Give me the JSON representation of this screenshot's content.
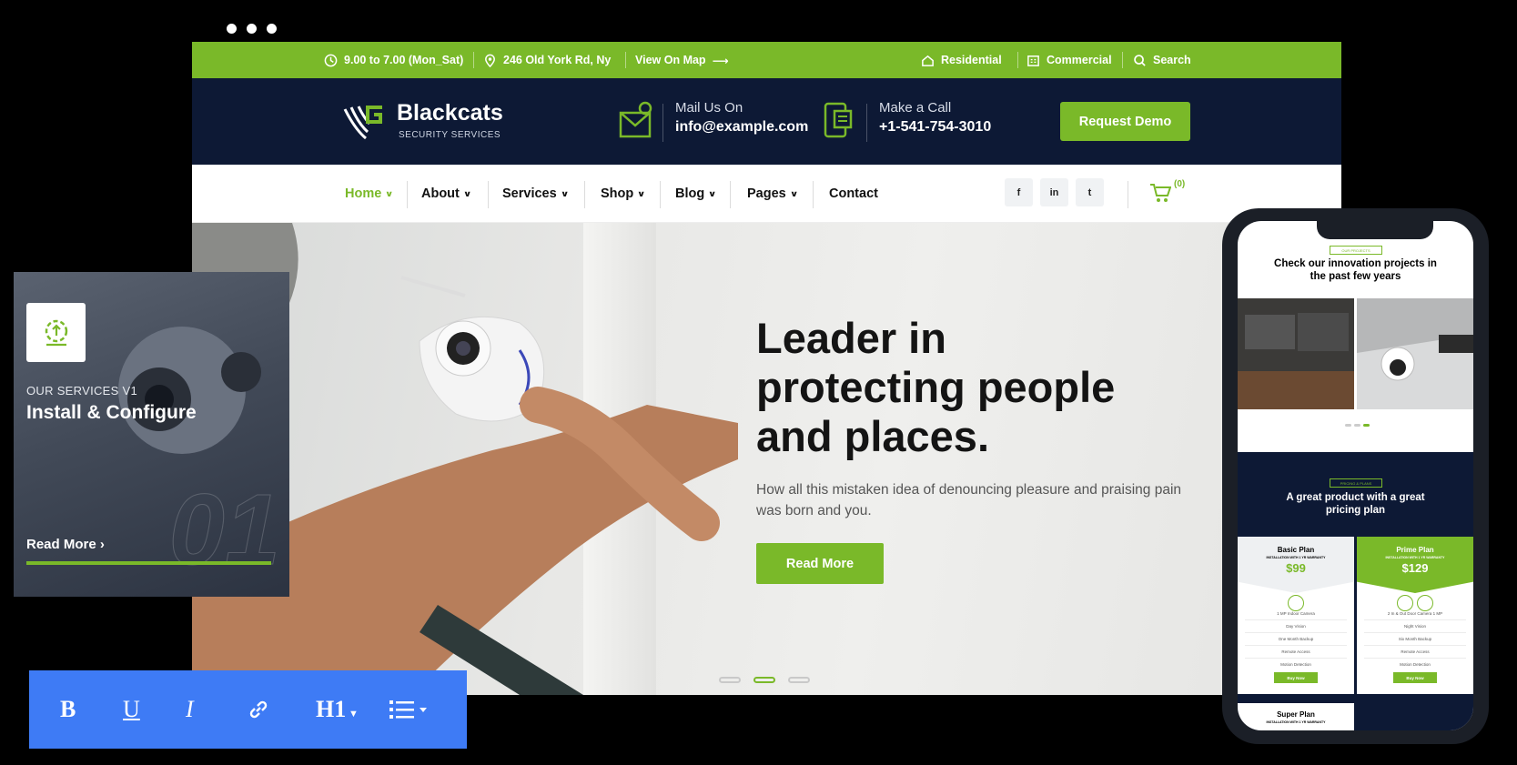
{
  "topbar": {
    "hours": "9.00 to 7.00 (Mon_Sat)",
    "address": "246 Old York Rd, Ny",
    "map_link": "View On Map",
    "residential": "Residential",
    "commercial": "Commercial",
    "search": "Search"
  },
  "brand": {
    "name": "Blackcats",
    "tagline": "SECURITY SERVICES",
    "mail_label": "Mail Us On",
    "mail_value": "info@example.com",
    "call_label": "Make a Call",
    "call_value": "+1-541-754-3010",
    "demo_button": "Request Demo"
  },
  "nav": {
    "items": [
      "Home",
      "About",
      "Services",
      "Shop",
      "Blog",
      "Pages",
      "Contact"
    ],
    "social": [
      "f",
      "in",
      "t"
    ],
    "cart_count": "(0)"
  },
  "hero": {
    "title_line1": "Leader in",
    "title_line2": "protecting people",
    "title_line3": "and places.",
    "text": "How all this mistaken idea of denouncing pleasure and praising pain was born and you.",
    "button": "Read More"
  },
  "service_card": {
    "kicker": "OUR SERVICES V1",
    "title": "Install & Configure",
    "ghost_number": "01",
    "link": "Read More"
  },
  "toolbar": {
    "bold": "B",
    "underline": "U",
    "italic": "I",
    "heading": "H1"
  },
  "phone": {
    "projects_kicker": "OUR PROJECTS",
    "projects_title_1": "Check our innovation projects in",
    "projects_title_2": "the past few years",
    "pricing_kicker": "PRICING & PLANS",
    "pricing_title_1": "A great product with a great",
    "pricing_title_2": "pricing plan",
    "plans": [
      {
        "name": "Basic Plan",
        "sub": "INSTALLATION WITH 1 YR WARRANTY",
        "price": "$99",
        "features": [
          "1 MP Indoor Camera",
          "Day Vision",
          "One Month Backup",
          "Remote Access",
          "Motion Detection"
        ],
        "button": "Buy Now"
      },
      {
        "name": "Prime Plan",
        "sub": "INSTALLATION WITH 1 YR WARRANTY",
        "price": "$129",
        "features": [
          "2 In & Out Door Camera 1 MP",
          "Night Vision",
          "Six Month Backup",
          "Remote Access",
          "Motion Detection"
        ],
        "button": "Buy Now"
      }
    ],
    "plan3_name": "Super Plan",
    "plan3_sub": "INSTALLATION WITH 1 YR WARRANTY"
  },
  "colors": {
    "accent": "#7ab929",
    "navy": "#0d1935",
    "toolbar_blue": "#3e7bf5"
  }
}
